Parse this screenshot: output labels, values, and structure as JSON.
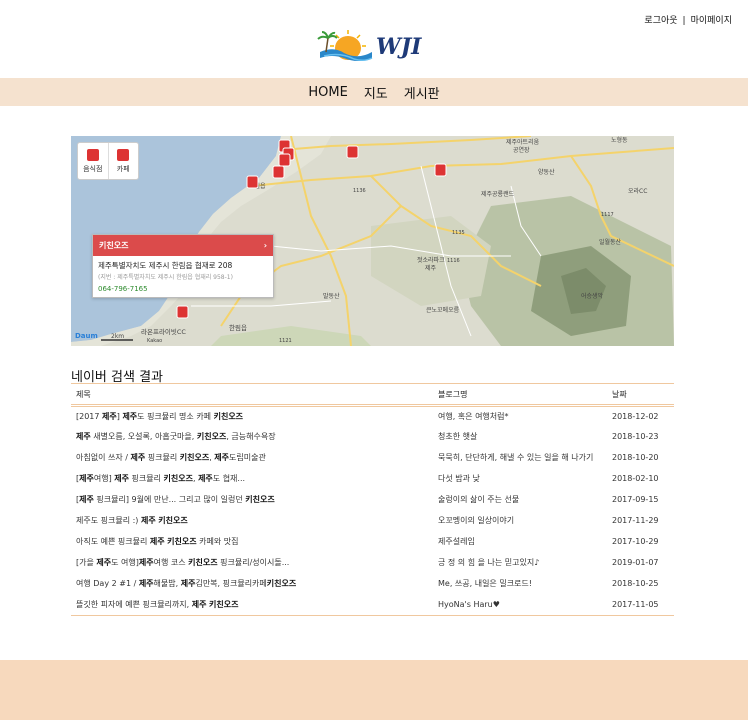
{
  "header": {
    "logout": "로그아웃",
    "sep": "|",
    "mypage": "마이페이지",
    "logo_text": "WJI"
  },
  "menu": [
    "HOME",
    "지도",
    "게시판"
  ],
  "map": {
    "ctrl_restaurant": "음식점",
    "ctrl_cafe": "카페",
    "info_title": "키친오즈",
    "info_arrow": "›",
    "info_address": "제주특별자치도 제주시 한림읍 협재로 208",
    "info_jibun": "(지번 : 제주특별자치도 제주시 한림읍 협재리 958-1)",
    "info_phone": "064-796-7165",
    "labels": [
      "제주아트리움",
      "공연장",
      "노형동",
      "양동산",
      "오라CC",
      "제주공룡랜드",
      "일월동산",
      "애월읍",
      "젓소라파크",
      "제주",
      "어승생악",
      "큰노꼬메오름",
      "말동산",
      "라온프라이빗CC",
      "한림읍",
      "1136",
      "1135",
      "1116",
      "1117",
      "1121",
      "2km",
      "Kakao",
      "Daum"
    ]
  },
  "results": {
    "title": "네이버 검색 결과",
    "columns": [
      "제목",
      "블로그명",
      "날짜"
    ],
    "rows": [
      {
        "title": [
          [
            "",
            "[2017 "
          ],
          [
            "b",
            "제주"
          ],
          [
            "",
            "] "
          ],
          [
            "b",
            "제주"
          ],
          [
            "",
            "도 핑크뮬리 명소 카페 "
          ],
          [
            "b",
            "키친오즈"
          ]
        ],
        "blog": "여행, 혹은 여행처럼*",
        "date": "2018-12-02"
      },
      {
        "title": [
          [
            "b",
            "제주"
          ],
          [
            "",
            "  새별오름, 오설록, 아홉굿마을, "
          ],
          [
            "b",
            "키친오즈"
          ],
          [
            "",
            ", 금능해수욕장"
          ]
        ],
        "blog": "청초한 햇살",
        "date": "2018-10-23"
      },
      {
        "title": [
          [
            "",
            "아침없이 쓰자 / "
          ],
          [
            "b",
            "제주"
          ],
          [
            "",
            "  핑크뮬리 "
          ],
          [
            "b",
            "키친오즈"
          ],
          [
            "",
            ", "
          ],
          [
            "b",
            "제주"
          ],
          [
            "",
            "도립미술관"
          ]
        ],
        "blog": "묵묵히, 단단하게, 해낼 수 있는 일을 해 나가기",
        "date": "2018-10-20"
      },
      {
        "title": [
          [
            "",
            "["
          ],
          [
            "b",
            "제주"
          ],
          [
            "",
            "여행] "
          ],
          [
            "b",
            "제주"
          ],
          [
            "",
            "  핑크뮬리 "
          ],
          [
            "b",
            "키친오즈"
          ],
          [
            "",
            ", "
          ],
          [
            "b",
            "제주"
          ],
          [
            "",
            "도 협재..."
          ]
        ],
        "blog": "다섯 밤과 낮",
        "date": "2018-02-10"
      },
      {
        "title": [
          [
            "",
            "["
          ],
          [
            "b",
            "제주"
          ],
          [
            "",
            "  핑크뮬리] 9월에 만난... 그리고 많이 일렁던 "
          ],
          [
            "b",
            "키친오즈"
          ]
        ],
        "blog": "술렁이의 삶이 주는 선물",
        "date": "2017-09-15"
      },
      {
        "title": [
          [
            "",
            "제주도 핑크뮬리 :) "
          ],
          [
            "b",
            "제주"
          ],
          [
            "",
            "  "
          ],
          [
            "b",
            "키친오즈"
          ]
        ],
        "blog": "오꼬멩이의 일상이야기",
        "date": "2017-11-29"
      },
      {
        "title": [
          [
            "",
            "아직도 예쁜 핑크뮬리 "
          ],
          [
            "b",
            "제주"
          ],
          [
            "",
            "  "
          ],
          [
            "b",
            "키친오즈"
          ],
          [
            "",
            "  카페와 맛집"
          ]
        ],
        "blog": "제주설레임",
        "date": "2017-10-29"
      },
      {
        "title": [
          [
            "",
            "[가을 "
          ],
          [
            "b",
            "제주"
          ],
          [
            "",
            "도 여행]"
          ],
          [
            "b",
            "제주"
          ],
          [
            "",
            "여행 코스 "
          ],
          [
            "b",
            "키친오즈"
          ],
          [
            "",
            "  핑크뮬리/성이시돌..."
          ]
        ],
        "blog": "긍 정 의 힘 을 나는 믿고있지♪",
        "date": "2019-01-07"
      },
      {
        "title": [
          [
            "",
            "여행 Day 2 #1 / "
          ],
          [
            "b",
            "제주"
          ],
          [
            "",
            "해물밥, "
          ],
          [
            "b",
            "제주"
          ],
          [
            "",
            "김만복, 핑크뮬리카페"
          ],
          [
            "b",
            "키친오즈"
          ]
        ],
        "blog": "Me, 쓰공, 내일은 밀크로드!",
        "date": "2018-10-25"
      },
      {
        "title": [
          [
            "",
            "뜰깃한 피자에 예쁜 핑크뮬리까지, "
          ],
          [
            "b",
            "제주"
          ],
          [
            "",
            "  "
          ],
          [
            "b",
            "키친오즈"
          ]
        ],
        "blog": "HyoNa's Haru♥",
        "date": "2017-11-05"
      }
    ]
  }
}
